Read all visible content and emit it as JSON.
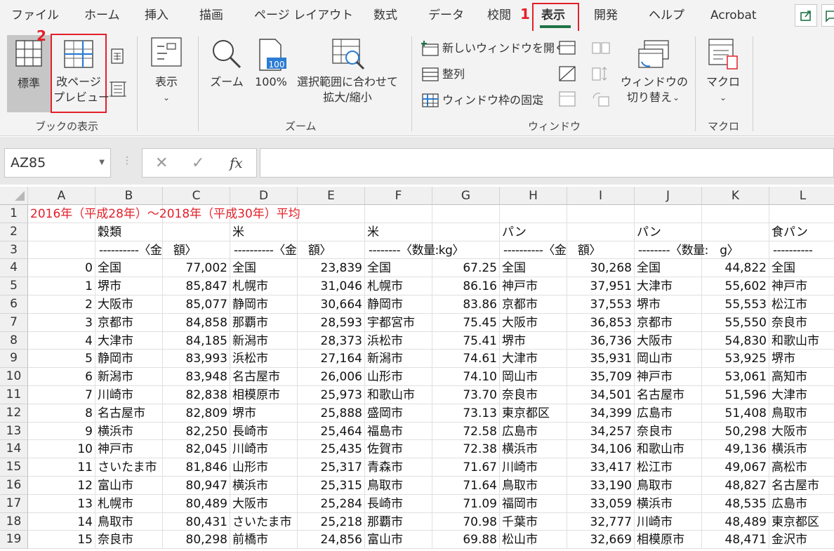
{
  "menu": {
    "tabs": [
      {
        "label": "ファイル"
      },
      {
        "label": "ホーム"
      },
      {
        "label": "挿入"
      },
      {
        "label": "描画"
      },
      {
        "label": "ページ レイアウト"
      },
      {
        "label": "数式"
      },
      {
        "label": "データ"
      },
      {
        "label": "校閲"
      },
      {
        "label": "表示"
      },
      {
        "label": "開発"
      },
      {
        "label": "ヘルプ"
      },
      {
        "label": "Acrobat"
      }
    ],
    "active_tab": "表示",
    "accent_color": "#217346",
    "share_icon": "share-icon",
    "comment_icon": "comment-icon"
  },
  "steps": {
    "one": "1",
    "two": "2"
  },
  "ribbon": {
    "book_view": {
      "normal": "標準",
      "page_break_1": "改ページ",
      "page_break_2": "プレビュー",
      "group": "ブックの表示"
    },
    "show": {
      "label": "表示"
    },
    "zoom": {
      "zoom": "ズーム",
      "zoom100_icon_text": "100",
      "zoom100": "100%",
      "fit_1": "選択範囲に合わせて",
      "fit_2": "拡大/縮小",
      "group": "ズーム"
    },
    "window": {
      "new_window": "新しいウィンドウを開く",
      "arrange": "整列",
      "freeze": "ウィンドウ枠の固定",
      "switch_1": "ウィンドウの",
      "switch_2": "切り替え",
      "group": "ウィンドウ"
    },
    "macro": {
      "label": "マクロ",
      "group": "マクロ"
    }
  },
  "formula_bar": {
    "name_box": "AZ85",
    "fx": "fx",
    "formula": ""
  },
  "sheet": {
    "columns": [
      "A",
      "B",
      "C",
      "D",
      "E",
      "F",
      "G",
      "H",
      "I",
      "J",
      "K",
      "L"
    ],
    "row1_title": "2016年（平成28年）～2018年（平成30年）平均",
    "row2": {
      "b": "穀類",
      "d": "米",
      "f": "米",
      "h": "パン",
      "j": "パン",
      "l": "食パン"
    },
    "row3": {
      "b": "----------〈金　額〉",
      "d": "----------〈金　額〉",
      "f": "--------〈数量:kg〉",
      "h": "----------〈金　額〉",
      "j": "--------〈数量:　g〉",
      "l": "----------"
    },
    "rows": [
      {
        "n": "4",
        "a": "0",
        "b": "全国",
        "c": "77,002",
        "d": "全国",
        "e": "23,839",
        "f": "全国",
        "g": "67.25",
        "h": "全国",
        "i": "30,268",
        "j": "全国",
        "k": "44,822",
        "l": "全国"
      },
      {
        "n": "5",
        "a": "1",
        "b": "堺市",
        "c": "85,847",
        "d": "札幌市",
        "e": "31,046",
        "f": "札幌市",
        "g": "86.16",
        "h": "神戸市",
        "i": "37,951",
        "j": "大津市",
        "k": "55,602",
        "l": "神戸市"
      },
      {
        "n": "6",
        "a": "2",
        "b": "大阪市",
        "c": "85,077",
        "d": "静岡市",
        "e": "30,664",
        "f": "静岡市",
        "g": "83.86",
        "h": "京都市",
        "i": "37,553",
        "j": "堺市",
        "k": "55,553",
        "l": "松江市"
      },
      {
        "n": "7",
        "a": "3",
        "b": "京都市",
        "c": "84,858",
        "d": "那覇市",
        "e": "28,593",
        "f": "宇都宮市",
        "g": "75.45",
        "h": "大阪市",
        "i": "36,853",
        "j": "京都市",
        "k": "55,550",
        "l": "奈良市"
      },
      {
        "n": "8",
        "a": "4",
        "b": "大津市",
        "c": "84,185",
        "d": "新潟市",
        "e": "28,373",
        "f": "浜松市",
        "g": "75.41",
        "h": "堺市",
        "i": "36,736",
        "j": "大阪市",
        "k": "54,830",
        "l": "和歌山市"
      },
      {
        "n": "9",
        "a": "5",
        "b": "静岡市",
        "c": "83,993",
        "d": "浜松市",
        "e": "27,164",
        "f": "新潟市",
        "g": "74.61",
        "h": "大津市",
        "i": "35,931",
        "j": "岡山市",
        "k": "53,925",
        "l": "堺市"
      },
      {
        "n": "10",
        "a": "6",
        "b": "新潟市",
        "c": "83,948",
        "d": "名古屋市",
        "e": "26,006",
        "f": "山形市",
        "g": "74.10",
        "h": "岡山市",
        "i": "35,709",
        "j": "神戸市",
        "k": "53,061",
        "l": "高知市"
      },
      {
        "n": "11",
        "a": "7",
        "b": "川崎市",
        "c": "82,838",
        "d": "相模原市",
        "e": "25,973",
        "f": "和歌山市",
        "g": "73.70",
        "h": "奈良市",
        "i": "34,501",
        "j": "名古屋市",
        "k": "51,596",
        "l": "大津市"
      },
      {
        "n": "12",
        "a": "8",
        "b": "名古屋市",
        "c": "82,809",
        "d": "堺市",
        "e": "25,888",
        "f": "盛岡市",
        "g": "73.13",
        "h": "東京都区",
        "i": "34,399",
        "j": "広島市",
        "k": "51,408",
        "l": "鳥取市"
      },
      {
        "n": "13",
        "a": "9",
        "b": "横浜市",
        "c": "82,250",
        "d": "長崎市",
        "e": "25,464",
        "f": "福島市",
        "g": "72.58",
        "h": "広島市",
        "i": "34,257",
        "j": "奈良市",
        "k": "50,298",
        "l": "大阪市"
      },
      {
        "n": "14",
        "a": "10",
        "b": "神戸市",
        "c": "82,045",
        "d": "川崎市",
        "e": "25,435",
        "f": "佐賀市",
        "g": "72.38",
        "h": "横浜市",
        "i": "34,106",
        "j": "和歌山市",
        "k": "49,136",
        "l": "横浜市"
      },
      {
        "n": "15",
        "a": "11",
        "b": "さいたま市",
        "c": "81,846",
        "d": "山形市",
        "e": "25,317",
        "f": "青森市",
        "g": "71.67",
        "h": "川崎市",
        "i": "33,417",
        "j": "松江市",
        "k": "49,067",
        "l": "高松市"
      },
      {
        "n": "16",
        "a": "12",
        "b": "富山市",
        "c": "80,947",
        "d": "横浜市",
        "e": "25,315",
        "f": "鳥取市",
        "g": "71.64",
        "h": "鳥取市",
        "i": "33,190",
        "j": "鳥取市",
        "k": "48,827",
        "l": "名古屋市"
      },
      {
        "n": "17",
        "a": "13",
        "b": "札幌市",
        "c": "80,489",
        "d": "大阪市",
        "e": "25,284",
        "f": "長崎市",
        "g": "71.09",
        "h": "福岡市",
        "i": "33,059",
        "j": "横浜市",
        "k": "48,535",
        "l": "広島市"
      },
      {
        "n": "18",
        "a": "14",
        "b": "鳥取市",
        "c": "80,431",
        "d": "さいたま市",
        "e": "25,218",
        "f": "那覇市",
        "g": "70.98",
        "h": "千葉市",
        "i": "32,777",
        "j": "川崎市",
        "k": "48,489",
        "l": "東京都区"
      },
      {
        "n": "19",
        "a": "15",
        "b": "奈良市",
        "c": "80,298",
        "d": "前橋市",
        "e": "24,856",
        "f": "富山市",
        "g": "69.88",
        "h": "松山市",
        "i": "32,669",
        "j": "相模原市",
        "k": "48,471",
        "l": "金沢市"
      }
    ]
  }
}
